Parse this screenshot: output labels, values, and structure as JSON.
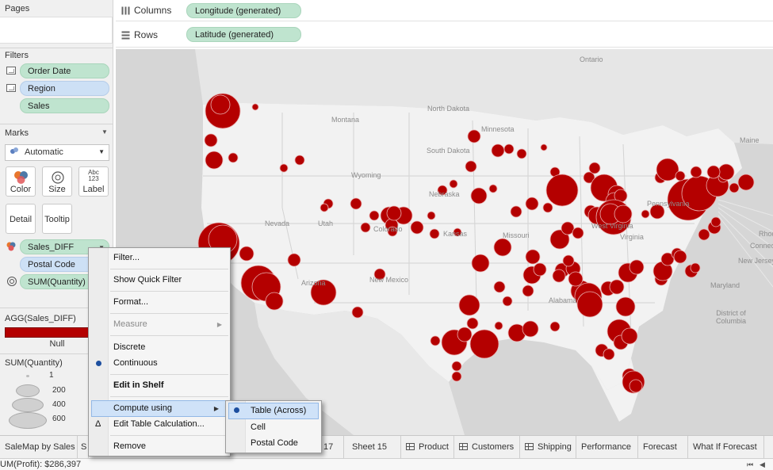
{
  "left_panel": {
    "pages_title": "Pages",
    "filters_title": "Filters",
    "filters": [
      "Order Date",
      "Region",
      "Sales"
    ],
    "marks_title": "Marks",
    "mark_type": "Automatic",
    "mark_buttons": {
      "color": "Color",
      "size": "Size",
      "label": "Label",
      "label_icon": "Abc\n123",
      "detail": "Detail",
      "tooltip": "Tooltip"
    },
    "mark_fields": [
      "Sales_DIFF",
      "Postal Code",
      "SUM(Quantity)"
    ],
    "legend_color_title": "AGG(Sales_DIFF)",
    "legend_color_null": "Null",
    "legend_color_swatch": "#b40000",
    "legend_size_title": "SUM(Quantity)",
    "legend_size_values": [
      "1",
      "200",
      "400",
      "600"
    ]
  },
  "shelves": {
    "columns_label": "Columns",
    "columns_pill": "Longitude (generated)",
    "rows_label": "Rows",
    "rows_pill": "Latitude (generated)"
  },
  "map": {
    "bubble_color": "#b40000",
    "labels": [
      "Ontario",
      "North Dakota",
      "Montana",
      "Minnesota",
      "South Dakota",
      "Wyoming",
      "Nebraska",
      "Nevada",
      "Utah",
      "Colorado",
      "Kansas",
      "Missouri",
      "Arizona",
      "New Mexico",
      "Alabama",
      "Pennsylvania",
      "West Virginia",
      "Virginia",
      "Maryland",
      "New Jersey",
      "District of Columbia",
      "Maine",
      "Rhode",
      "Connecticut"
    ]
  },
  "context_menu": {
    "items": [
      "Filter...",
      "Show Quick Filter",
      "Format...",
      "Measure",
      "Discrete",
      "Continuous",
      "Edit in Shelf",
      "Compute using",
      "Edit Table Calculation...",
      "Remove"
    ],
    "delta_glyph": "Δ"
  },
  "submenu": {
    "items": [
      "Table (Across)",
      "Cell",
      "Postal Code"
    ]
  },
  "tabs": [
    "SaleMap by Sales",
    "S",
    "17",
    "Sheet 15",
    "Product",
    "Customers",
    "Shipping",
    "Performance",
    "Forecast",
    "What If Forecast"
  ],
  "status": {
    "text": "UM(Profit): $286,397"
  }
}
